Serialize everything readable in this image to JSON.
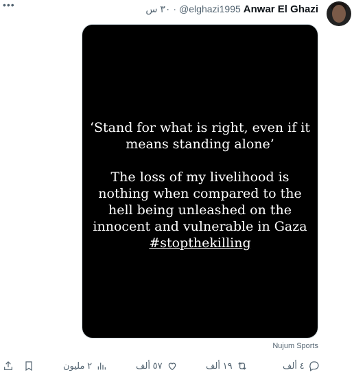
{
  "tweet": {
    "author_name": "Anwar El Ghazi",
    "handle": "@elghazi1995",
    "separator": "·",
    "time": "٣٠ س",
    "more_icon": "more-horizontal-icon",
    "avatar": "avatar-photo",
    "media": {
      "lines_1": [
        "‘Stand for what is right, even if it",
        "means standing alone’"
      ],
      "lines_2": [
        "The loss of my livelihood is",
        "nothing when compared to the",
        "hell being unleashed on the",
        "innocent and vulnerable in Gaza"
      ],
      "hashtag": "#stopthekilling"
    },
    "source_label": "Nujum Sports"
  },
  "actions": {
    "reply": {
      "icon": "reply-icon",
      "count": "٤ ألف"
    },
    "retweet": {
      "icon": "retweet-icon",
      "count": "١٩ ألف"
    },
    "like": {
      "icon": "heart-icon",
      "count": "٥٧ ألف"
    },
    "views": {
      "icon": "views-icon",
      "count": "٢ مليون"
    },
    "bookmark": {
      "icon": "bookmark-icon"
    },
    "share": {
      "icon": "share-icon"
    }
  }
}
